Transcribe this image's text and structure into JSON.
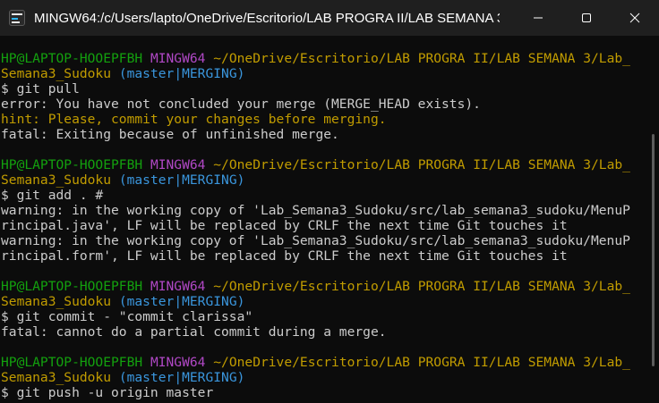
{
  "window": {
    "title": "MINGW64:/c/Users/lapto/OneDrive/Escritorio/LAB PROGRA II/LAB SEMANA 3...",
    "controls": {
      "minimize": "minimize-icon",
      "maximize": "maximize-icon",
      "close": "close-icon"
    }
  },
  "colors": {
    "user": "#13a10e",
    "mingw": "#b148c6",
    "path": "#c19c00",
    "branch": "#3a96dd",
    "text": "#cccccc",
    "background": "#0c0c0c"
  },
  "terminal": {
    "blocks": [
      {
        "prompt": {
          "user": "HP@LAPTOP-HOOEPFBH",
          "env": "MINGW64",
          "path": "~/OneDrive/Escritorio/LAB PROGRA II/LAB SEMANA 3/Lab_",
          "path_cont": "Semana3_Sudoku",
          "branch": "(master|MERGING)"
        },
        "command": "$ git pull",
        "output": [
          {
            "text": "error: You have not concluded your merge (MERGE_HEAD exists).",
            "style": "white"
          },
          {
            "text": "hint: Please, commit your changes before merging.",
            "style": "hint"
          },
          {
            "text": "fatal: Exiting because of unfinished merge.",
            "style": "white"
          }
        ]
      },
      {
        "prompt": {
          "user": "HP@LAPTOP-HOOEPFBH",
          "env": "MINGW64",
          "path": "~/OneDrive/Escritorio/LAB PROGRA II/LAB SEMANA 3/Lab_",
          "path_cont": "Semana3_Sudoku",
          "branch": "(master|MERGING)"
        },
        "command": "$ git add . #",
        "output": [
          {
            "text": "warning: in the working copy of 'Lab_Semana3_Sudoku/src/lab_semana3_sudoku/MenuP",
            "style": "white"
          },
          {
            "text": "rincipal.java', LF will be replaced by CRLF the next time Git touches it",
            "style": "white"
          },
          {
            "text": "warning: in the working copy of 'Lab_Semana3_Sudoku/src/lab_semana3_sudoku/MenuP",
            "style": "white"
          },
          {
            "text": "rincipal.form', LF will be replaced by CRLF the next time Git touches it",
            "style": "white"
          }
        ]
      },
      {
        "prompt": {
          "user": "HP@LAPTOP-HOOEPFBH",
          "env": "MINGW64",
          "path": "~/OneDrive/Escritorio/LAB PROGRA II/LAB SEMANA 3/Lab_",
          "path_cont": "Semana3_Sudoku",
          "branch": "(master|MERGING)"
        },
        "command": "$ git commit - \"commit clarissa\"",
        "output": [
          {
            "text": "fatal: cannot do a partial commit during a merge.",
            "style": "white"
          }
        ]
      },
      {
        "prompt": {
          "user": "HP@LAPTOP-HOOEPFBH",
          "env": "MINGW64",
          "path": "~/OneDrive/Escritorio/LAB PROGRA II/LAB SEMANA 3/Lab_",
          "path_cont": "Semana3_Sudoku",
          "branch": "(master|MERGING)"
        },
        "command": "$ git push -u origin master",
        "output": []
      }
    ]
  }
}
